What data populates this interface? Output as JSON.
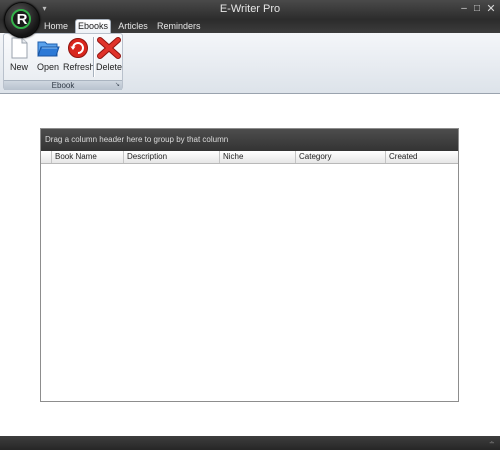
{
  "window": {
    "title": "E-Writer Pro",
    "logo_letter": "R",
    "qat_arrow": "▾",
    "controls": {
      "minimize": "–",
      "maximize": "□",
      "close": "✕"
    }
  },
  "ribbon": {
    "tabs": [
      {
        "label": "Home",
        "active": false
      },
      {
        "label": "Ebooks",
        "active": true
      },
      {
        "label": "Articles",
        "active": false
      },
      {
        "label": "Reminders",
        "active": false
      }
    ],
    "groups": [
      {
        "label": "Ebook",
        "launcher": "↘",
        "buttons": [
          {
            "label": "New",
            "icon": "new-document-icon"
          },
          {
            "label": "Open",
            "icon": "open-folder-icon"
          },
          {
            "label": "Refresh",
            "icon": "refresh-icon"
          },
          {
            "label": "Delete",
            "icon": "delete-x-icon"
          }
        ]
      }
    ]
  },
  "grid": {
    "group_panel_text": "Drag a column header here to group by that column",
    "columns": [
      "Book Name",
      "Description",
      "Niche",
      "Category",
      "Created"
    ],
    "rows": []
  },
  "colors": {
    "chrome_dark": "#2b2b2b",
    "ribbon_light": "#eef2f6",
    "group_panel": "#3d3d3d",
    "delete_red": "#d8261d",
    "refresh_red": "#c8221d",
    "folder_blue": "#2c79d6"
  }
}
